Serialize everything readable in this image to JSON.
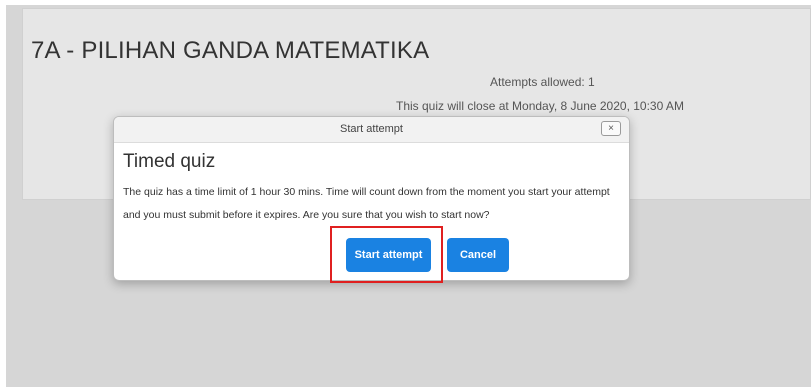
{
  "quiz": {
    "title": "7A - PILIHAN GANDA MATEMATIKA",
    "attempts_allowed": "Attempts allowed: 1",
    "close_info": "This quiz will close at Monday, 8 June 2020, 10:30 AM"
  },
  "dialog": {
    "header_title": "Start attempt",
    "close_icon": "×",
    "heading": "Timed quiz",
    "message": "The quiz has a time limit of 1 hour 30 mins. Time will count down from the moment you start your attempt and you must submit before it expires. Are you sure that you wish to start now?",
    "start_label": "Start attempt",
    "cancel_label": "Cancel"
  },
  "colors": {
    "button_primary": "#1a82e2",
    "highlight": "#e02020",
    "overlay_background": "#d6d6d6"
  }
}
